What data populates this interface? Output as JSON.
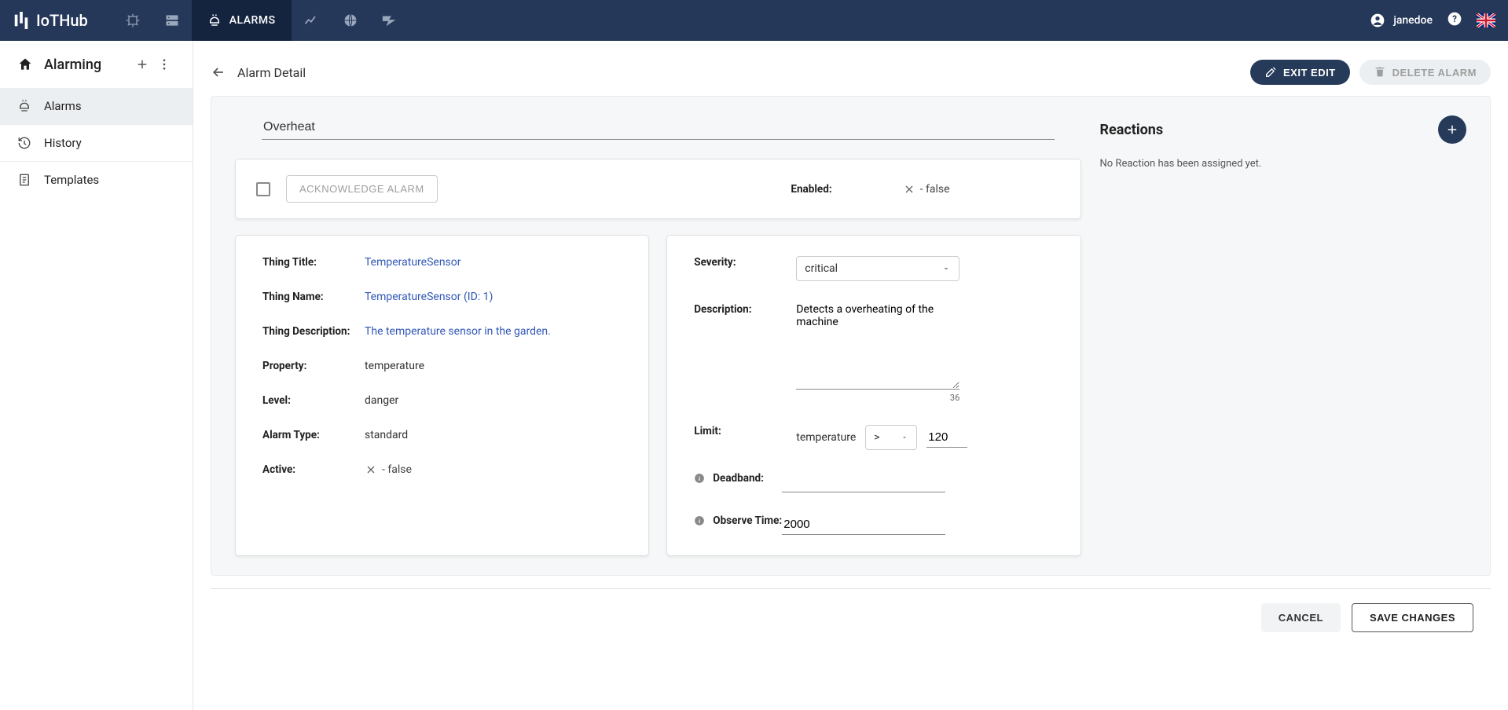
{
  "brand": "IoTHub",
  "topnav": {
    "alarms_label": "ALARMS"
  },
  "user": {
    "name": "janedoe"
  },
  "sidebar": {
    "title": "Alarming",
    "items": [
      {
        "label": "Alarms"
      },
      {
        "label": "History"
      },
      {
        "label": "Templates"
      }
    ]
  },
  "page": {
    "title": "Alarm Detail",
    "exit_edit": "Exit Edit",
    "delete": "Delete Alarm"
  },
  "alarm": {
    "name": "Overheat",
    "ack_button": "ACKNOWLEDGE ALARM",
    "enabled_label": "Enabled:",
    "enabled_value": "- false",
    "thing_title_label": "Thing Title:",
    "thing_title_value": "TemperatureSensor",
    "thing_name_label": "Thing Name:",
    "thing_name_value": "TemperatureSensor (ID: 1)",
    "thing_desc_label": "Thing Description:",
    "thing_desc_value": "The temperature sensor in the garden.",
    "property_label": "Property:",
    "property_value": "temperature",
    "level_label": "Level:",
    "level_value": "danger",
    "alarm_type_label": "Alarm Type:",
    "alarm_type_value": "standard",
    "active_label": "Active:",
    "active_value": "- false",
    "severity_label": "Severity:",
    "severity_value": "critical",
    "description_label": "Description:",
    "description_value": "Detects a overheating of the machine",
    "description_count": "36",
    "limit_label": "Limit:",
    "limit_property": "temperature",
    "limit_operator": ">",
    "limit_value": "120",
    "deadband_label": "Deadband:",
    "deadband_value": "",
    "observe_label": "Observe Time:",
    "observe_value": "2000"
  },
  "reactions": {
    "title": "Reactions",
    "empty": "No Reaction has been assigned yet."
  },
  "footer": {
    "cancel": "CANCEL",
    "save": "SAVE CHANGES"
  }
}
